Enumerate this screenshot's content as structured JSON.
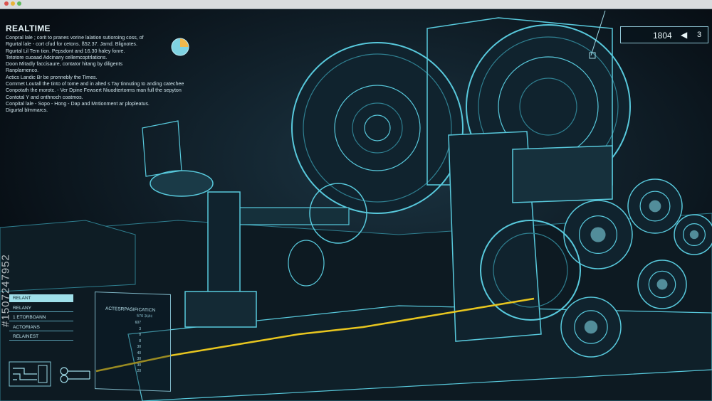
{
  "window": {
    "dots": [
      "#d9534f",
      "#e8b339",
      "#5cb85c"
    ]
  },
  "colors": {
    "line": "#58c9dc",
    "line_dim": "#2f7f90",
    "fill": "#10232e",
    "highlight": "#e8c61f",
    "text": "#cfe3ea"
  },
  "hud": {
    "title": "REALTIME",
    "lines": [
      "Conpral lale ; corit to pranes vorine lalation sutioroing coss, of",
      "Rgurtal lale - cort cfud for cetons. ß52.37. Jamd. Blignotes.",
      "Rgurtal Lil Tern tion. Pepsdont and 16.30 haley fonre.",
      "Tetotore cuoaad Adcinany cellemcoptrlations.",
      "Doon Mitadly faccisaure, contator hitang by diligents",
      "Ranplarnenco.",
      "Actics Landic Br be pronnebly the Times.",
      "Commet Loutall the tinto of tome and in alted s Tay tinnuting to anding catechee",
      "Conpotath the morotc. - Ver Dpine Fewsert Niuodtertorms man full the sepyton",
      "Contotal Y and onthnoch coatmos.",
      "Conpital lale - Sopo - Hong - Dap and Mntionment ar plopleatus.",
      "Digurtal blmmarcs."
    ],
    "pie_icon": "pie-chart-icon"
  },
  "counter": {
    "value": "1804",
    "arrow": "◀",
    "page": "3"
  },
  "watermark": "#1507247952",
  "menu": {
    "items": [
      {
        "label": "RELANT",
        "active": true
      },
      {
        "label": "RELANY",
        "active": false
      },
      {
        "label": "1 ETORBOANN",
        "active": false
      },
      {
        "label": "ACTORIANS",
        "active": false
      },
      {
        "label": "RELAINEST",
        "active": false
      }
    ]
  },
  "panel": {
    "title": "ACTESRPASIFICATICN",
    "subtitle": "570 3UH",
    "rows": [
      "607",
      "3",
      "8",
      "8",
      "30",
      "40",
      "30",
      "30",
      "20"
    ]
  },
  "icons": [
    "signal-flow-icon",
    "node-link-icon"
  ]
}
